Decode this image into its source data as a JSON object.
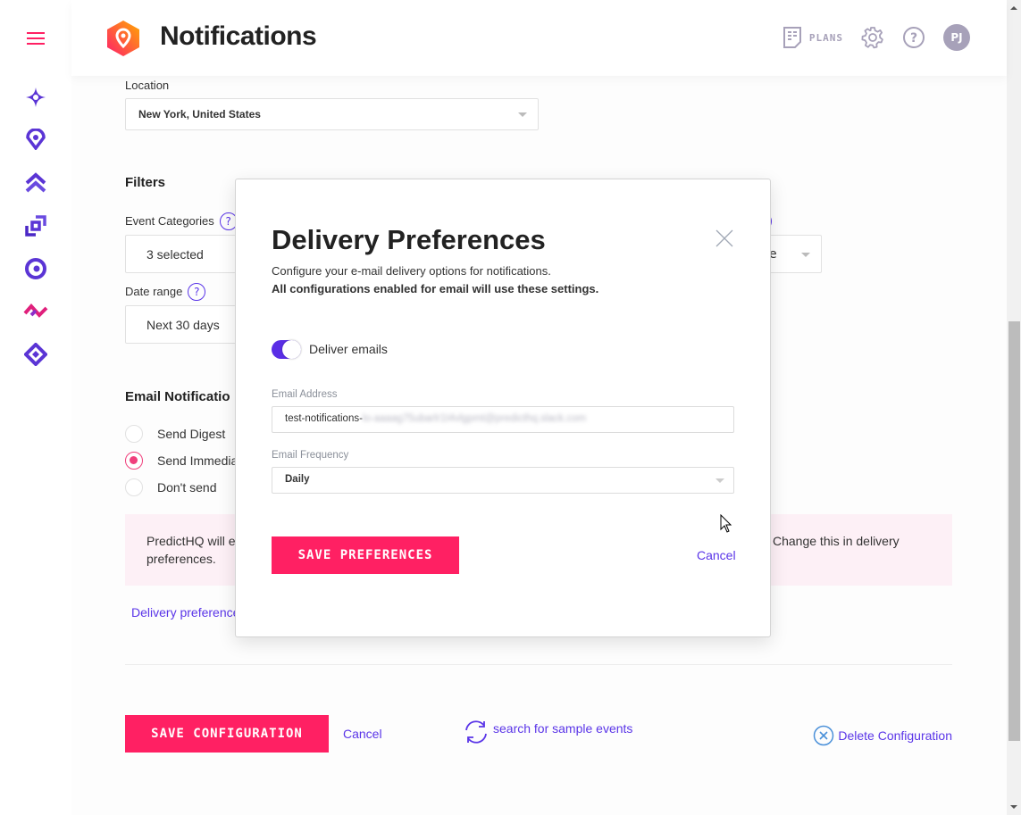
{
  "header": {
    "title": "Notifications",
    "plans_label": "PLANS",
    "avatar_initials": "PJ"
  },
  "sidebar": {
    "items": [
      {
        "icon": "sparkle-icon",
        "color": "#5b35d5"
      },
      {
        "icon": "location-pin-icon",
        "color": "#5b35d5"
      },
      {
        "icon": "double-chevron-up-icon",
        "color": "#5b35d5"
      },
      {
        "icon": "squares-icon",
        "color": "#5b35d5"
      },
      {
        "icon": "target-icon",
        "color": "#5b35d5"
      },
      {
        "icon": "zigzag-icon",
        "color": "#e0207c"
      },
      {
        "icon": "diamond-icon",
        "color": "#5b35d5"
      }
    ]
  },
  "form": {
    "location_label": "Location",
    "location_value": "New York, United States",
    "filters_title": "Filters",
    "event_categories_label": "Event Categories",
    "event_categories_value": "3 selected",
    "third_select_partial": "e",
    "date_range_label": "Date range",
    "date_range_value": "Next 30 days",
    "email_notifications_title": "Email Notificatio",
    "radio_options": [
      {
        "label": "Send Digest",
        "selected": false
      },
      {
        "label": "Send Immedia",
        "selected": true
      },
      {
        "label": "Don't send",
        "selected": false
      }
    ],
    "info_text_left": "PredictHQ will e",
    "info_text_left_2": "preferences.",
    "info_text_right": "Change this in delivery",
    "delivery_prefs_link": "Delivery preference"
  },
  "footer": {
    "save_label": "SAVE CONFIGURATION",
    "cancel_label": "Cancel",
    "sample_events_label": "search for sample events",
    "delete_label": "Delete Configuration"
  },
  "modal": {
    "title": "Delivery Preferences",
    "description": "Configure your e-mail delivery options for notifications.",
    "description_bold": "All configurations enabled for email will use these settings.",
    "toggle_label": "Deliver emails",
    "toggle_on": true,
    "email_label": "Email Address",
    "email_value_visible": "test-notifications-",
    "email_value_blurred": "lo-aaaag75ubarlr1t4vlgpmt@predicthq.slack.com",
    "frequency_label": "Email Frequency",
    "frequency_value": "Daily",
    "save_label": "SAVE PREFERENCES",
    "cancel_label": "Cancel"
  },
  "colors": {
    "brand_pink": "#ff2063",
    "accent_purple": "#5a35e8",
    "info_bg": "#fdf0f6",
    "muted_icon": "#a7a1b9"
  }
}
